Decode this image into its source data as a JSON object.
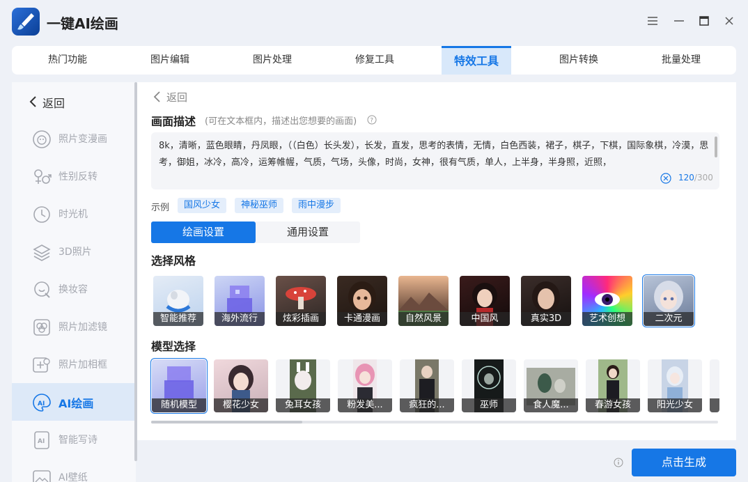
{
  "app": {
    "title": "一键AI绘画"
  },
  "tabs": [
    {
      "label": "热门功能"
    },
    {
      "label": "图片编辑"
    },
    {
      "label": "图片处理"
    },
    {
      "label": "修复工具"
    },
    {
      "label": "特效工具"
    },
    {
      "label": "图片转换"
    },
    {
      "label": "批量处理"
    }
  ],
  "active_tab": "特效工具",
  "sidebar": {
    "back_label": "返回",
    "items": [
      {
        "label": "照片变漫画",
        "icon": "cartoon-face-icon"
      },
      {
        "label": "性别反转",
        "icon": "gender-swap-icon"
      },
      {
        "label": "时光机",
        "icon": "time-machine-icon"
      },
      {
        "label": "3D照片",
        "icon": "layers-3d-icon"
      },
      {
        "label": "换妆容",
        "icon": "makeup-icon"
      },
      {
        "label": "照片加滤镜",
        "icon": "filter-icon"
      },
      {
        "label": "照片加相框",
        "icon": "frame-icon"
      },
      {
        "label": "AI绘画",
        "icon": "ai-paint-icon"
      },
      {
        "label": "智能写诗",
        "icon": "ai-poem-icon"
      },
      {
        "label": "AI壁纸",
        "icon": "ai-wallpaper-icon"
      }
    ],
    "active_item": "AI绘画"
  },
  "main": {
    "back_label": "返回",
    "desc_title": "画面描述",
    "desc_hint": "(可在文本框内，描述出您想要的画面)",
    "desc_text": "8k，清晰，蓝色眼睛，丹凤眼，（（白色）长头发），长发，直发，思考的表情，无情，白色西装，裙子，棋子，下棋，国际象棋，冷漠，思考，御姐，冰冷，高冷，运筹帷幄，气质，气场，头像，时尚，女神，很有气质，单人，上半身，半身照，近照，",
    "char_count": "120",
    "char_max": "/300",
    "examples_label": "示例",
    "examples": [
      "国风少女",
      "神秘巫师",
      "雨中漫步"
    ],
    "settings_tabs": [
      "绘画设置",
      "通用设置"
    ],
    "style_title": "选择风格",
    "styles": [
      "智能推荐",
      "海外流行",
      "炫彩插画",
      "卡通漫画",
      "自然风景",
      "中国风",
      "真实3D",
      "艺术创想",
      "二次元"
    ],
    "selected_style": "二次元",
    "model_title": "模型选择",
    "models": [
      "随机模型",
      "樱花少女",
      "兔耳女孩",
      "粉发美...",
      "疯狂的...",
      "巫师",
      "食人魔...",
      "春游女孩",
      "阳光少女"
    ],
    "selected_model": "随机模型"
  },
  "generate_label": "点击生成",
  "colors": {
    "accent": "#1677e6",
    "bg": "#eef1f7"
  }
}
